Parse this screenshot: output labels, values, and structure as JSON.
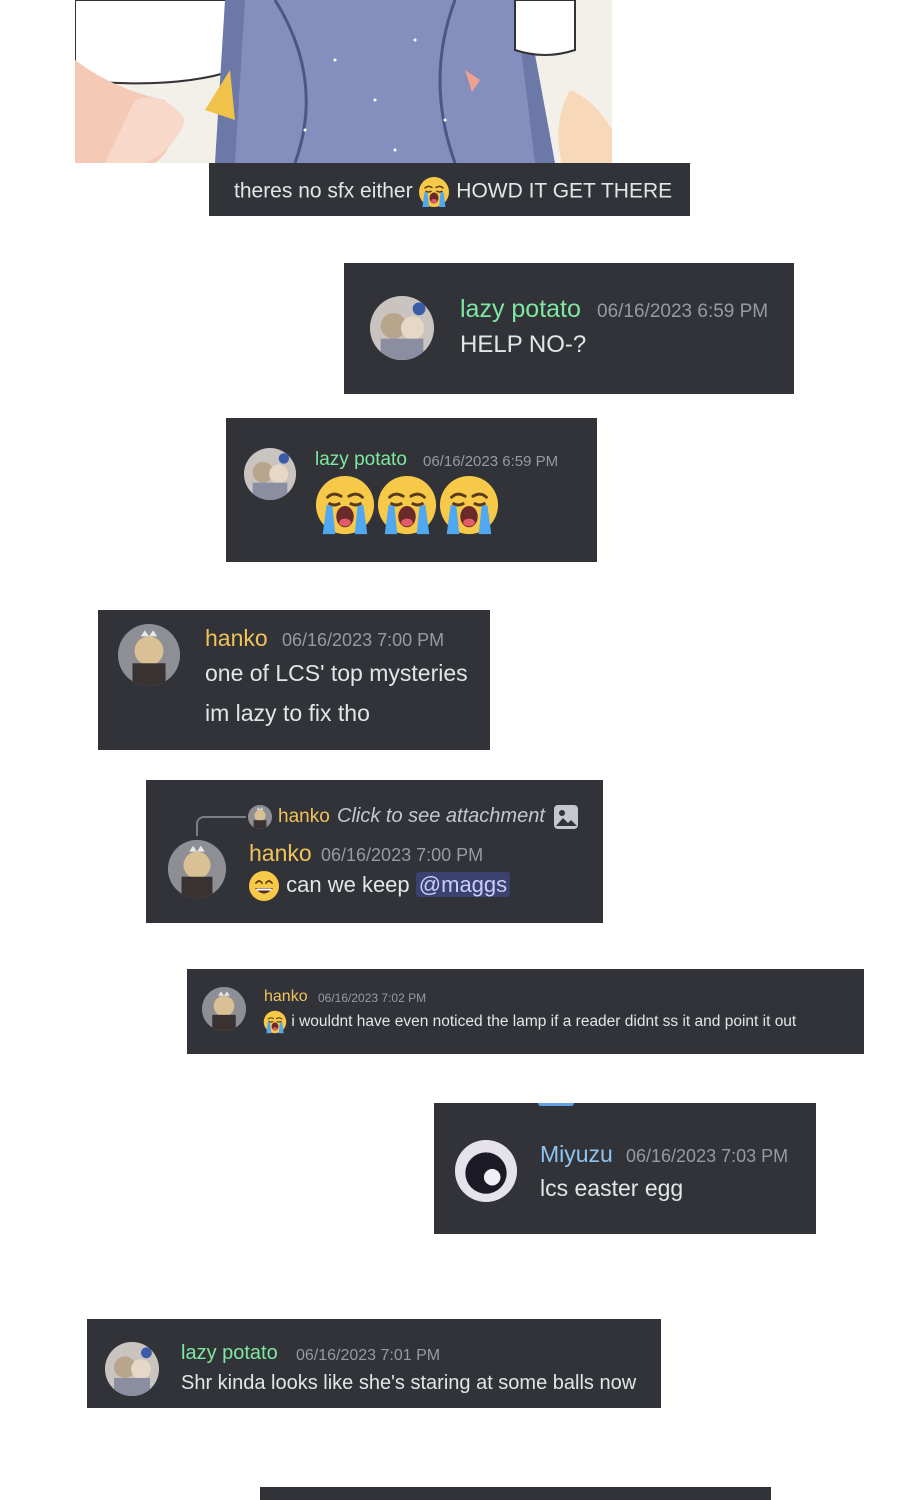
{
  "caption": {
    "text_before": "theres no sfx either",
    "emoji": "loudly-crying-face",
    "text_after": "HOWD IT GET THERE"
  },
  "messages": [
    {
      "author": "lazy potato",
      "timestamp": "06/16/2023 6:59 PM",
      "lines": [
        "HELP NO-?"
      ]
    },
    {
      "author": "lazy potato",
      "timestamp": "06/16/2023 6:59 PM",
      "emoji": [
        "loudly-crying-face",
        "loudly-crying-face",
        "loudly-crying-face"
      ]
    },
    {
      "author": "hanko",
      "timestamp": "06/16/2023 7:00 PM",
      "lines": [
        "one of LCS' top mysteries",
        "im lazy to fix tho"
      ]
    },
    {
      "author": "hanko",
      "timestamp": "06/16/2023 7:00 PM",
      "reply": {
        "author": "hanko",
        "text": "Click to see attachment",
        "icon": "image-icon"
      },
      "emoji": "grinning-face",
      "text": "can we keep",
      "mention": "@maggs"
    },
    {
      "author": "hanko",
      "timestamp": "06/16/2023 7:02 PM",
      "emoji": "loudly-crying-face",
      "text": "i wouldnt have even noticed the lamp if a reader didnt ss it and point it out"
    },
    {
      "author": "Miyuzu",
      "timestamp": "06/16/2023 7:03 PM",
      "lines": [
        "lcs easter egg"
      ]
    },
    {
      "author": "lazy potato",
      "timestamp": "06/16/2023 7:01 PM",
      "lines": [
        "Shr kinda looks like she's staring at some balls now"
      ]
    }
  ],
  "colors": {
    "card_bg": "#313338",
    "lazy_potato": "#7ee8a0",
    "hanko": "#f0c45a",
    "miyuzu": "#8fc4f2",
    "timestamp": "#949ba4",
    "mention_bg": "#3c4270"
  }
}
